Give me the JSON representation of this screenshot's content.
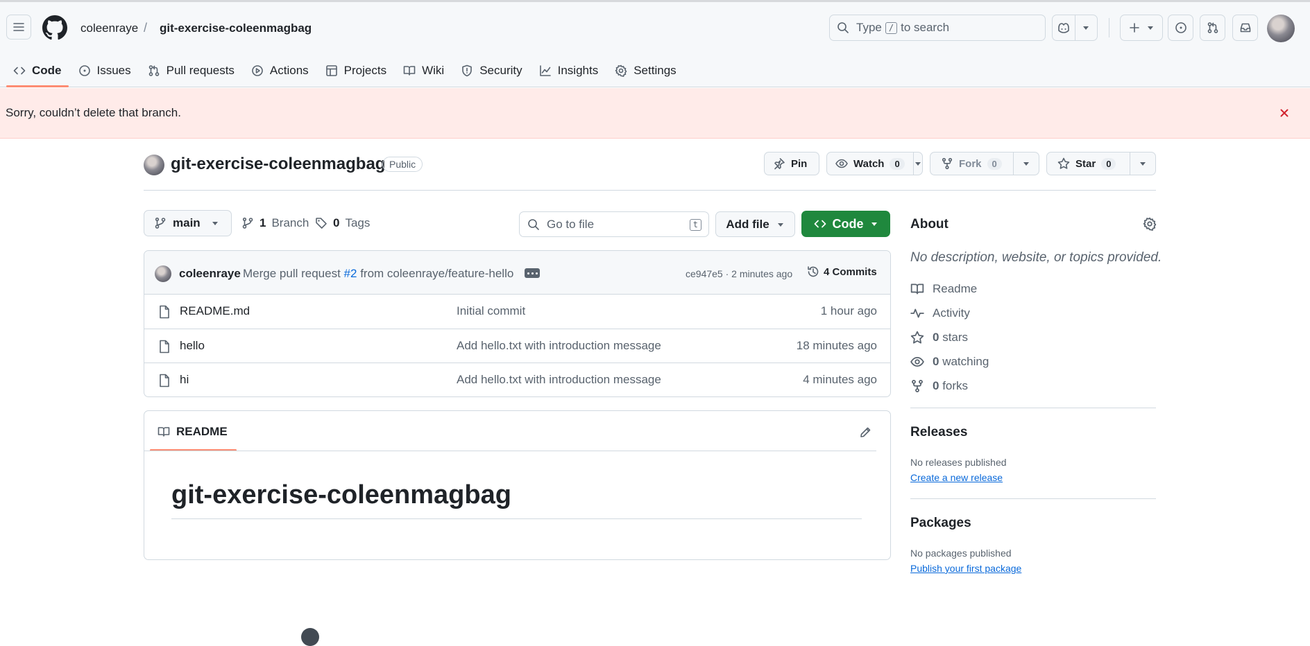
{
  "header": {
    "owner": "coleenraye",
    "separator": "/",
    "repo": "git-exercise-coleenmagbag",
    "search_prefix": "Type",
    "search_key": "/",
    "search_suffix": "to search"
  },
  "nav": {
    "tabs": [
      {
        "label": "Code",
        "icon": "code-icon",
        "active": true
      },
      {
        "label": "Issues",
        "icon": "issue-opened-icon"
      },
      {
        "label": "Pull requests",
        "icon": "git-pull-request-icon"
      },
      {
        "label": "Actions",
        "icon": "play-icon"
      },
      {
        "label": "Projects",
        "icon": "table-icon"
      },
      {
        "label": "Wiki",
        "icon": "book-icon"
      },
      {
        "label": "Security",
        "icon": "shield-icon"
      },
      {
        "label": "Insights",
        "icon": "graph-icon"
      },
      {
        "label": "Settings",
        "icon": "gear-icon"
      }
    ]
  },
  "flash": {
    "message": "Sorry, couldn’t delete that branch.",
    "close_icon": "x-icon",
    "color": "#ffebe9"
  },
  "repo": {
    "title": "git-exercise-coleenmagbag",
    "visibility": "Public",
    "pin_label": "Pin",
    "watch_label": "Watch",
    "watch_count": "0",
    "fork_label": "Fork",
    "fork_count": "0",
    "star_label": "Star",
    "star_count": "0"
  },
  "branchbar": {
    "branch": "main",
    "branch_count": "1",
    "branch_word": "Branch",
    "tag_count": "0",
    "tag_word": "Tags",
    "goto_placeholder": "Go to file",
    "goto_key": "t",
    "add_file": "Add file",
    "code_button": "Code",
    "code_color": "#1f883d"
  },
  "commit": {
    "author": "coleenraye",
    "msg_prefix": "Merge pull request",
    "pr_ref": "#2",
    "msg_suffix": "from coleenraye/feature-hello",
    "meta": "ce947e5 · 2 minutes ago",
    "commits_label": "4 Commits"
  },
  "files": [
    {
      "name": "README.md",
      "message": "Initial commit",
      "age": "1 hour ago"
    },
    {
      "name": "hello",
      "message": "Add hello.txt with introduction message",
      "age": "18 minutes ago"
    },
    {
      "name": "hi",
      "message": "Add hello.txt with introduction message",
      "age": "4 minutes ago"
    }
  ],
  "readme": {
    "tab_label": "README",
    "heading": "git-exercise-coleenmagbag"
  },
  "sidebar": {
    "about_title": "About",
    "about_desc": "No description, website, or topics provided.",
    "readme_link": "Readme",
    "activity_link": "Activity",
    "stars_count": "0",
    "stars_word": "stars",
    "watching_count": "0",
    "watching_word": "watching",
    "forks_count": "0",
    "forks_word": "forks",
    "releases_title": "Releases",
    "releases_text": "No releases published",
    "releases_link": "Create a new release",
    "packages_title": "Packages",
    "packages_text": "No packages published",
    "packages_link": "Publish your first package"
  }
}
